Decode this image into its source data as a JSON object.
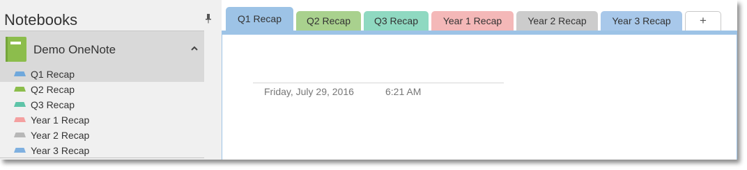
{
  "sidebar": {
    "header": "Notebooks",
    "pin_icon": "pin-icon",
    "notebook": {
      "name": "Demo OneNote",
      "icon": "notebook-icon",
      "color": "#8cbd4c",
      "collapse_icon": "chevron-up-icon"
    },
    "sections": [
      {
        "label": "Q1 Recap",
        "color": "#6fa8dc",
        "active": true
      },
      {
        "label": "Q2 Recap",
        "color": "#8cbd4c",
        "active": false
      },
      {
        "label": "Q3 Recap",
        "color": "#5ec4a8",
        "active": false
      },
      {
        "label": "Year 1 Recap",
        "color": "#f4a0a0",
        "active": false
      },
      {
        "label": "Year 2 Recap",
        "color": "#b7b7b7",
        "active": false
      },
      {
        "label": "Year 3 Recap",
        "color": "#7fb0e0",
        "active": false
      }
    ]
  },
  "tabs": [
    {
      "label": "Q1 Recap",
      "color": "#9dc3e6",
      "active": true
    },
    {
      "label": "Q2 Recap",
      "color": "#a9d18e",
      "active": false
    },
    {
      "label": "Q3 Recap",
      "color": "#8fd9c1",
      "active": false
    },
    {
      "label": "Year 1 Recap",
      "color": "#f4b8b8",
      "active": false
    },
    {
      "label": "Year 2 Recap",
      "color": "#cccccc",
      "active": false
    },
    {
      "label": "Year 3 Recap",
      "color": "#a8c8ea",
      "active": false
    }
  ],
  "add_tab_label": "+",
  "page": {
    "date": "Friday, July 29, 2016",
    "time": "6:21 AM"
  }
}
